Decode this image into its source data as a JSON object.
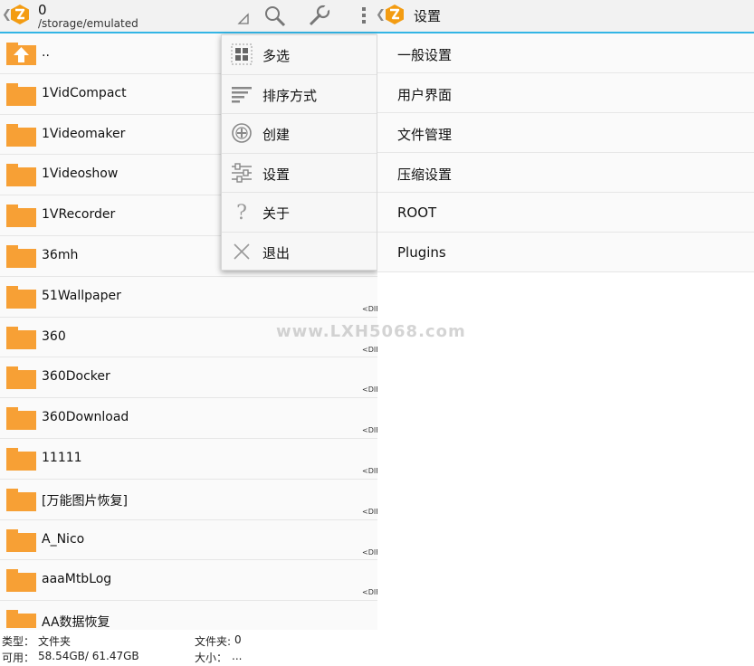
{
  "left_header": {
    "title": "0",
    "path": "/storage/emulated"
  },
  "files": [
    {
      "name": "..",
      "type": "up",
      "dir": ""
    },
    {
      "name": "1VidCompact",
      "type": "folder",
      "dir": ""
    },
    {
      "name": "1Videomaker",
      "type": "folder",
      "dir": ""
    },
    {
      "name": "1Videoshow",
      "type": "folder",
      "dir": ""
    },
    {
      "name": "1VRecorder",
      "type": "folder",
      "dir": ""
    },
    {
      "name": "36mh",
      "type": "folder",
      "dir": ""
    },
    {
      "name": "51Wallpaper",
      "type": "folder",
      "dir": "<DIF"
    },
    {
      "name": "360",
      "type": "folder",
      "dir": "<DIF"
    },
    {
      "name": "360Docker",
      "type": "folder",
      "dir": "<DIF"
    },
    {
      "name": "360Download",
      "type": "folder",
      "dir": "<DIF"
    },
    {
      "name": "11111",
      "type": "folder",
      "dir": "<DIF"
    },
    {
      "name": "[万能图片恢复]",
      "type": "folder",
      "dir": "<DIF"
    },
    {
      "name": "A_Nico",
      "type": "folder",
      "dir": "<DIF"
    },
    {
      "name": "aaaMtbLog",
      "type": "folder",
      "dir": "<DIF"
    },
    {
      "name": "AA数据恢复",
      "type": "folder",
      "dir": ""
    }
  ],
  "status": {
    "type_label": "类型：",
    "type_value": "文件夹",
    "folders_label": "文件夹:",
    "folders_value": "0",
    "avail_label": "可用：",
    "avail_value": "58.54GB/ 61.47GB",
    "size_label": "大小：",
    "size_value": "..."
  },
  "menu": {
    "items": [
      {
        "label": "多选",
        "icon": "multi-select-icon"
      },
      {
        "label": "排序方式",
        "icon": "sort-icon"
      },
      {
        "label": "创建",
        "icon": "create-icon"
      },
      {
        "label": "设置",
        "icon": "settings-sliders-icon"
      },
      {
        "label": "关于",
        "icon": "help-icon"
      },
      {
        "label": "退出",
        "icon": "close-icon"
      }
    ]
  },
  "right_header": {
    "title": "设置"
  },
  "settings": {
    "items": [
      "一般设置",
      "用户界面",
      "文件管理",
      "压缩设置",
      "ROOT",
      "Plugins"
    ]
  },
  "watermark": "www.LXH5068.com",
  "colors": {
    "accent": "#33b5e5",
    "folder": "#f7a035",
    "logo": "#f39c12"
  }
}
